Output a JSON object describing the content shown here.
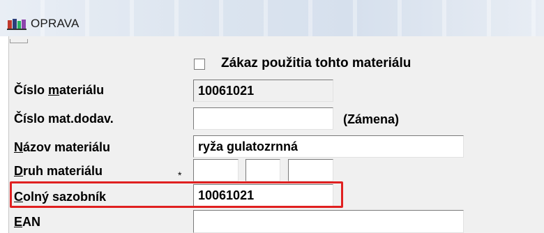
{
  "window": {
    "title": "OPRAVA"
  },
  "form": {
    "checkbox_label": "Zákaz použitia tohto materiálu",
    "checkbox_checked": false,
    "fields": {
      "cislo_materialu": {
        "label_pre": "Číslo ",
        "label_ul": "m",
        "label_post": "ateriálu",
        "value": "10061021"
      },
      "cislo_mat_dodav": {
        "label": "Číslo mat.dodav.",
        "value": "",
        "suffix": "(Zámena)"
      },
      "nazov_materialu": {
        "label_ul": "N",
        "label_post": "ázov materiálu",
        "value": "ryža gulatozrnná"
      },
      "druh_materialu": {
        "label_ul": "D",
        "label_post": "ruh materiálu",
        "required_mark": "*",
        "values": [
          "",
          "",
          ""
        ]
      },
      "colny_sazobnik": {
        "label_ul": "C",
        "label_post": "olný sazobník",
        "value": "10061021"
      },
      "ean": {
        "label_ul": "E",
        "label_post": "AN",
        "value": ""
      }
    }
  },
  "colors": {
    "highlight": "#e02020",
    "window_bg": "#f0f0f0"
  }
}
